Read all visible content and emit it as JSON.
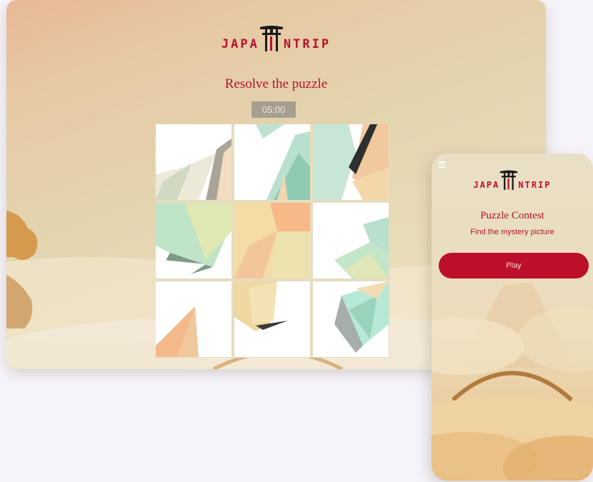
{
  "desktop": {
    "brand": "JAPANTRIP",
    "title": "Resolve the puzzle",
    "timer": "05:00",
    "puzzle": {
      "rows": 3,
      "columns": 3
    }
  },
  "mobile": {
    "brand": "JAPANTRIP",
    "title": "Puzzle Contest",
    "subtitle": "Find the mystery picture",
    "play_label": "Play"
  },
  "colors": {
    "accent": "#b8122e",
    "button": "#bb0f2c",
    "timer_bg": "#a69f90",
    "page_bg": "#f6f4fa"
  },
  "icons": [
    "torii-gate-icon",
    "hamburger-menu-icon"
  ]
}
